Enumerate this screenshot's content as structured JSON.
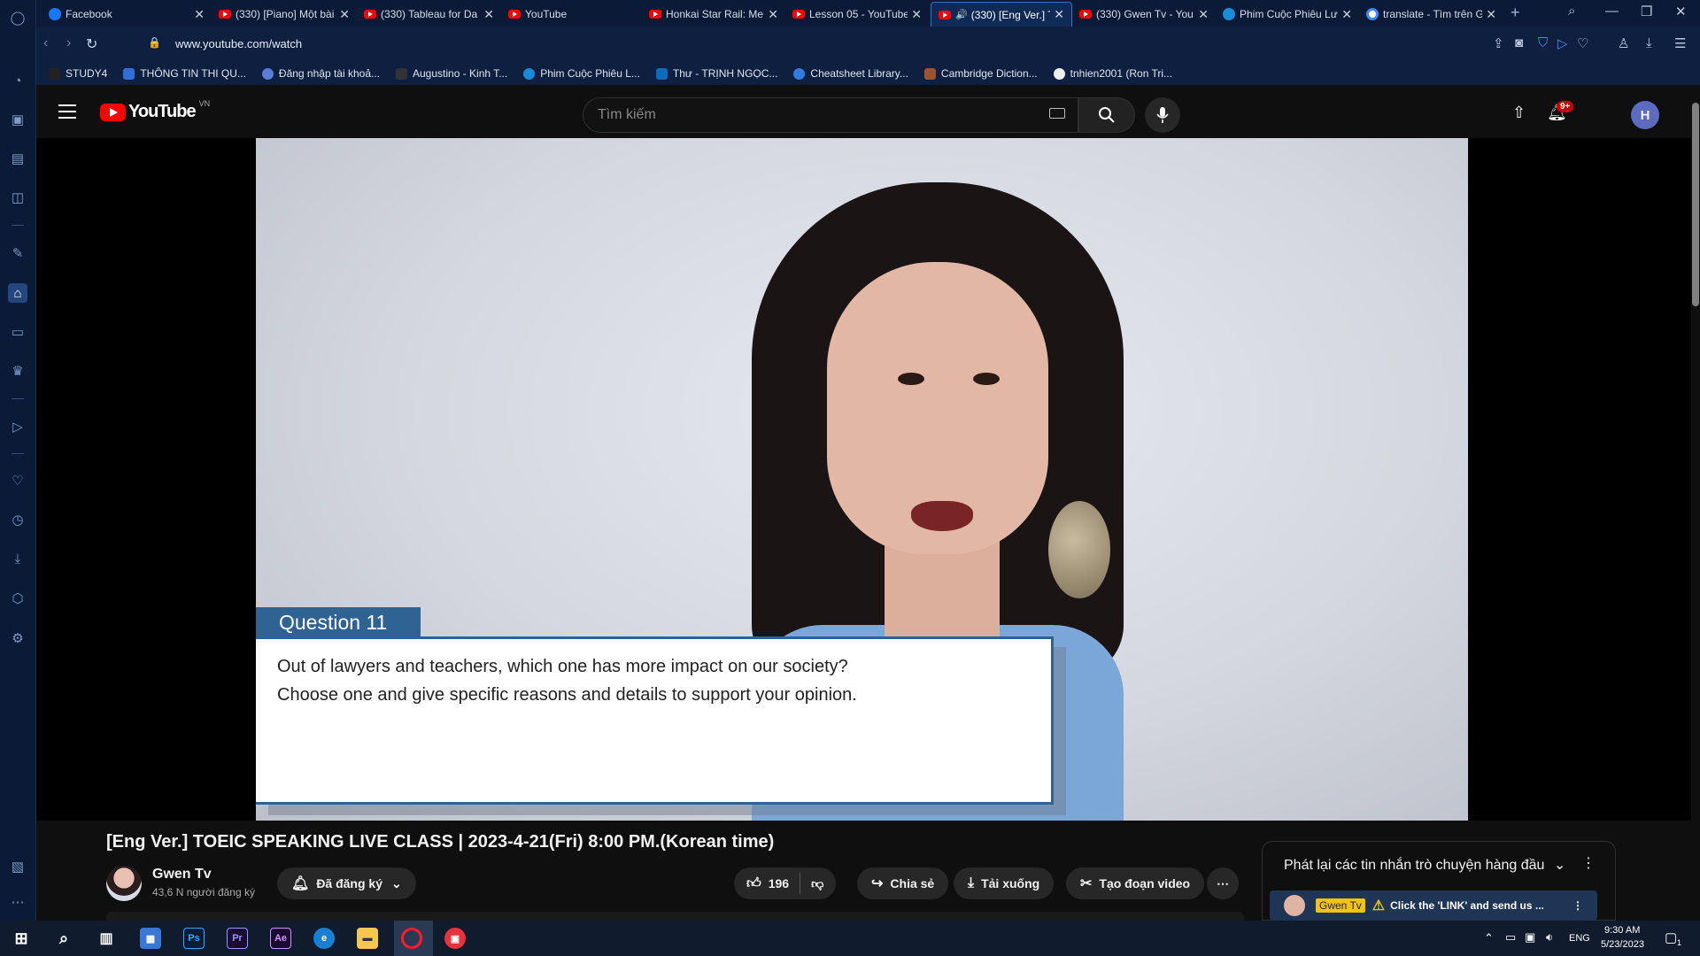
{
  "browser": {
    "tabs": [
      {
        "title": "Facebook",
        "icon": "facebook-icon",
        "active": false
      },
      {
        "title": "(330) [Piano] Một bài",
        "icon": "youtube-icon",
        "active": false
      },
      {
        "title": "(330) Tableau for Da",
        "icon": "youtube-icon",
        "active": false
      },
      {
        "title": "YouTube",
        "icon": "youtube-icon",
        "active": false
      },
      {
        "title": "Honkai Star Rail: Me",
        "icon": "youtube-icon",
        "active": false
      },
      {
        "title": "Lesson 05 - YouTube",
        "icon": "youtube-icon",
        "active": false
      },
      {
        "title": "(330) [Eng Ver.] T",
        "icon": "youtube-icon",
        "active": true,
        "audio": true
      },
      {
        "title": "(330) Gwen Tv - You",
        "icon": "youtube-icon",
        "active": false
      },
      {
        "title": "Phim Cuộc Phiêu Lư",
        "icon": "globe-icon",
        "active": false
      },
      {
        "title": "translate - Tìm trên G",
        "icon": "google-icon",
        "active": false
      }
    ],
    "url": "www.youtube.com/watch",
    "bookmarks": [
      {
        "label": "STUDY4",
        "color": "#222222"
      },
      {
        "label": "THÔNG TIN THI QU...",
        "color": "#2f6fd6"
      },
      {
        "label": "Đăng nhập tài khoả...",
        "color": "#5b7fd6"
      },
      {
        "label": "Augustino - Kinh T...",
        "color": "#333333"
      },
      {
        "label": "Phim Cuộc Phiêu L...",
        "color": "#1a8bd6"
      },
      {
        "label": "Thư - TRỊNH NGỌC...",
        "color": "#0f6cbd"
      },
      {
        "label": "Cheatsheet Library...",
        "color": "#2f7de1"
      },
      {
        "label": "Cambridge Diction...",
        "color": "#a0522d"
      },
      {
        "label": "tnhien2001 (Ron Tri...",
        "color": "#eeeeee"
      }
    ]
  },
  "youtube": {
    "logo_text": "YouTube",
    "country_code": "VN",
    "search_placeholder": "Tìm kiếm",
    "notification_count": "9+",
    "avatar_letter": "H"
  },
  "video": {
    "question_label": "Question 11",
    "question_line1": "Out of lawyers and teachers, which one has more impact on our society?",
    "question_line2": "Choose one and give specific reasons and details to support your opinion.",
    "title": "[Eng Ver.] TOEIC SPEAKING LIVE CLASS | 2023-4-21(Fri) 8:00 PM.(Korean time)",
    "channel_name": "Gwen Tv",
    "channel_subs": "43,6 N người đăng ký",
    "subscribe_label": "Đã đăng ký",
    "like_count": "196",
    "share_label": "Chia sẻ",
    "download_label": "Tải xuống",
    "clip_label": "Tạo đoạn video"
  },
  "chat": {
    "title": "Phát lại các tin nhắn trò chuyện hàng đầu",
    "pinned_badge": "Gwen Tv",
    "pinned_text": "Click the 'LINK' and send us ..."
  },
  "taskbar": {
    "language": "ENG",
    "time": "9:30 AM",
    "date": "5/23/2023",
    "notif_count": "1"
  }
}
